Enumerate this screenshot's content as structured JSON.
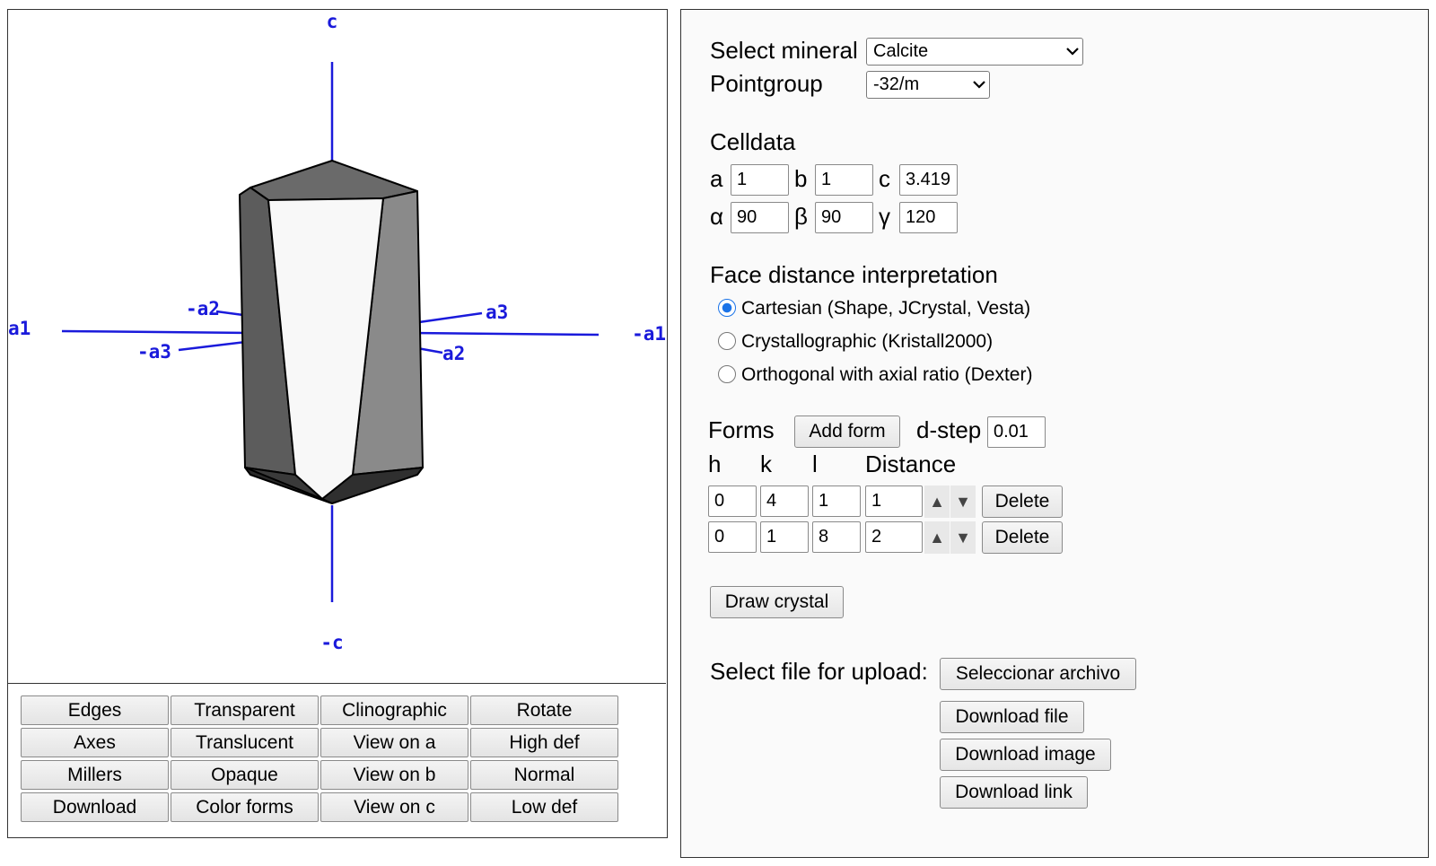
{
  "viewer": {
    "axis_labels": {
      "c": "c",
      "neg_c": "-c",
      "a1": "a1",
      "neg_a1": "-a1",
      "a2": "a2",
      "neg_a2": "-a2",
      "a3": "a3",
      "neg_a3": "-a3"
    },
    "colors": {
      "axis": "#1a1adb",
      "face_dark": "#3a3a3a",
      "face_mid": "#6a6a6a",
      "face_light": "#8c8c8c",
      "face_white": "#f8f8f8"
    },
    "buttons": [
      "Edges",
      "Transparent",
      "Clinographic",
      "Rotate",
      "Axes",
      "Translucent",
      "View on a",
      "High def",
      "Millers",
      "Opaque",
      "View on b",
      "Normal",
      "Download",
      "Color forms",
      "View on c",
      "Low def"
    ]
  },
  "form": {
    "mineral_label": "Select mineral",
    "mineral_value": "Calcite",
    "pointgroup_label": "Pointgroup",
    "pointgroup_value": "-32/m",
    "celldata_label": "Celldata",
    "cell": {
      "a_label": "a",
      "a": "1",
      "b_label": "b",
      "b": "1",
      "c_label": "c",
      "c": "3.419",
      "alpha_label": "α",
      "alpha": "90",
      "beta_label": "β",
      "beta": "90",
      "gamma_label": "γ",
      "gamma": "120"
    },
    "face_distance_label": "Face distance interpretation",
    "interpretations": [
      {
        "label": "Cartesian (Shape, JCrystal, Vesta)",
        "checked": true
      },
      {
        "label": "Crystallographic (Kristall2000)",
        "checked": false
      },
      {
        "label": "Orthogonal with axial ratio (Dexter)",
        "checked": false
      }
    ],
    "forms_label": "Forms",
    "add_form_button": "Add form",
    "dstep_label": "d-step",
    "dstep_value": "0.01",
    "columns": {
      "h": "h",
      "k": "k",
      "l": "l",
      "distance": "Distance"
    },
    "rows": [
      {
        "h": "0",
        "k": "4",
        "l": "1",
        "distance": "1"
      },
      {
        "h": "0",
        "k": "1",
        "l": "8",
        "distance": "2"
      }
    ],
    "step_up": "▲",
    "step_down": "▼",
    "delete_button": "Delete",
    "draw_button": "Draw crystal",
    "upload_label": "Select file for upload:",
    "choose_file_button": "Seleccionar archivo",
    "download_file_button": "Download file",
    "download_image_button": "Download image",
    "download_link_button": "Download link"
  }
}
